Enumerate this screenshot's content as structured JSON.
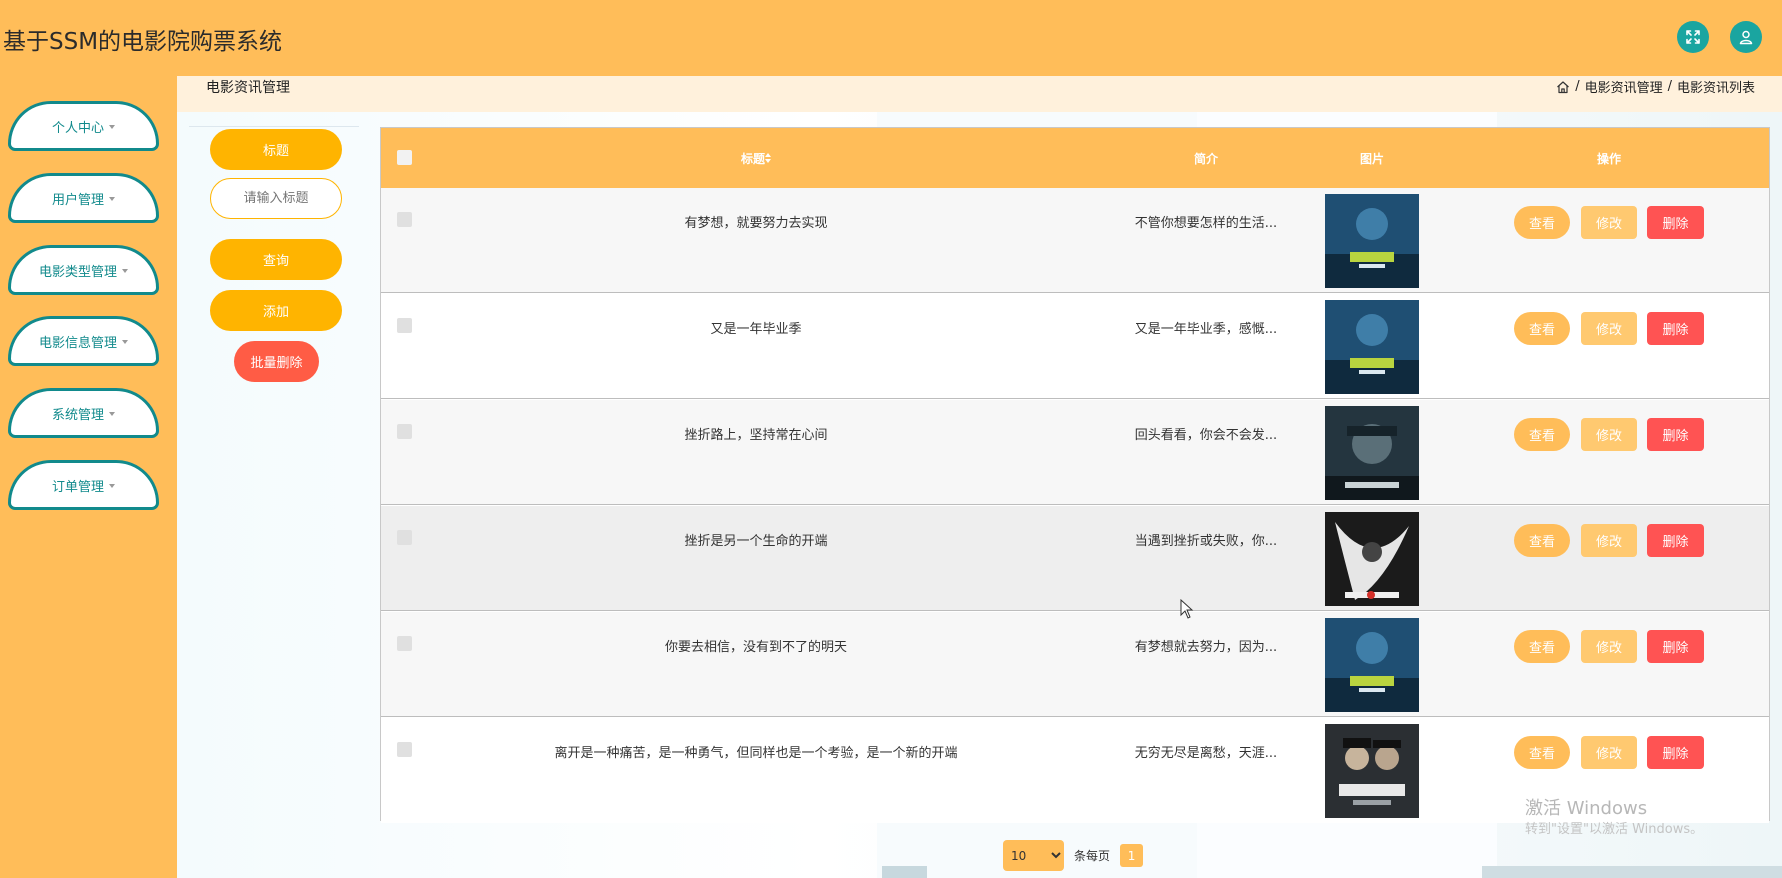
{
  "app": {
    "title": "基于SSM的电影院购票系统"
  },
  "header": {
    "fullscreen_icon": "fullscreen-icon",
    "user_icon": "user-icon",
    "accent_color": "#1aa5a0",
    "bg_color": "#ffbd59"
  },
  "sidebar": {
    "items": [
      {
        "label": "个人中心"
      },
      {
        "label": "用户管理"
      },
      {
        "label": "电影类型管理"
      },
      {
        "label": "电影信息管理"
      },
      {
        "label": "系统管理"
      },
      {
        "label": "订单管理"
      }
    ]
  },
  "breadcrumb": {
    "page_title": "电影资讯管理",
    "home_icon": "home-icon",
    "path": [
      "电影资讯管理",
      "电影资讯列表"
    ],
    "sep": "/"
  },
  "search": {
    "field_label": "标题",
    "placeholder": "请输入标题",
    "query_label": "查询",
    "add_label": "添加",
    "batch_delete_label": "批量删除"
  },
  "table": {
    "columns": [
      "标题",
      "简介",
      "图片",
      "操作"
    ],
    "sort_icon": "sort-icon",
    "rows": [
      {
        "title": "有梦想，就要努力去实现",
        "intro": "不管你想要怎样的生活...",
        "poster": "blue-poster"
      },
      {
        "title": "又是一年毕业季",
        "intro": "又是一年毕业季，感慨...",
        "poster": "blue-poster"
      },
      {
        "title": "挫折路上，坚持常在心间",
        "intro": "回头看看，你会不会发...",
        "poster": "dark-poster"
      },
      {
        "title": "挫折是另一个生命的开端",
        "intro": "当遇到挫折或失败，你...",
        "poster": "shadow-poster"
      },
      {
        "title": "你要去相信，没有到不了的明天",
        "intro": "有梦想就去努力，因为...",
        "poster": "blue-poster"
      },
      {
        "title": "离开是一种痛苦，是一种勇气，但同样也是一个考验，是一个新的开端",
        "intro": "无穷无尽是离愁，天涯...",
        "poster": "sherlock-poster"
      }
    ],
    "actions": {
      "view": "查看",
      "edit": "修改",
      "delete": "删除"
    }
  },
  "pager": {
    "page_size": "10",
    "per_page_label": "条每页",
    "current_page": "1"
  },
  "watermark": {
    "title": "激活 Windows",
    "subtitle": "转到\"设置\"以激活 Windows。"
  }
}
